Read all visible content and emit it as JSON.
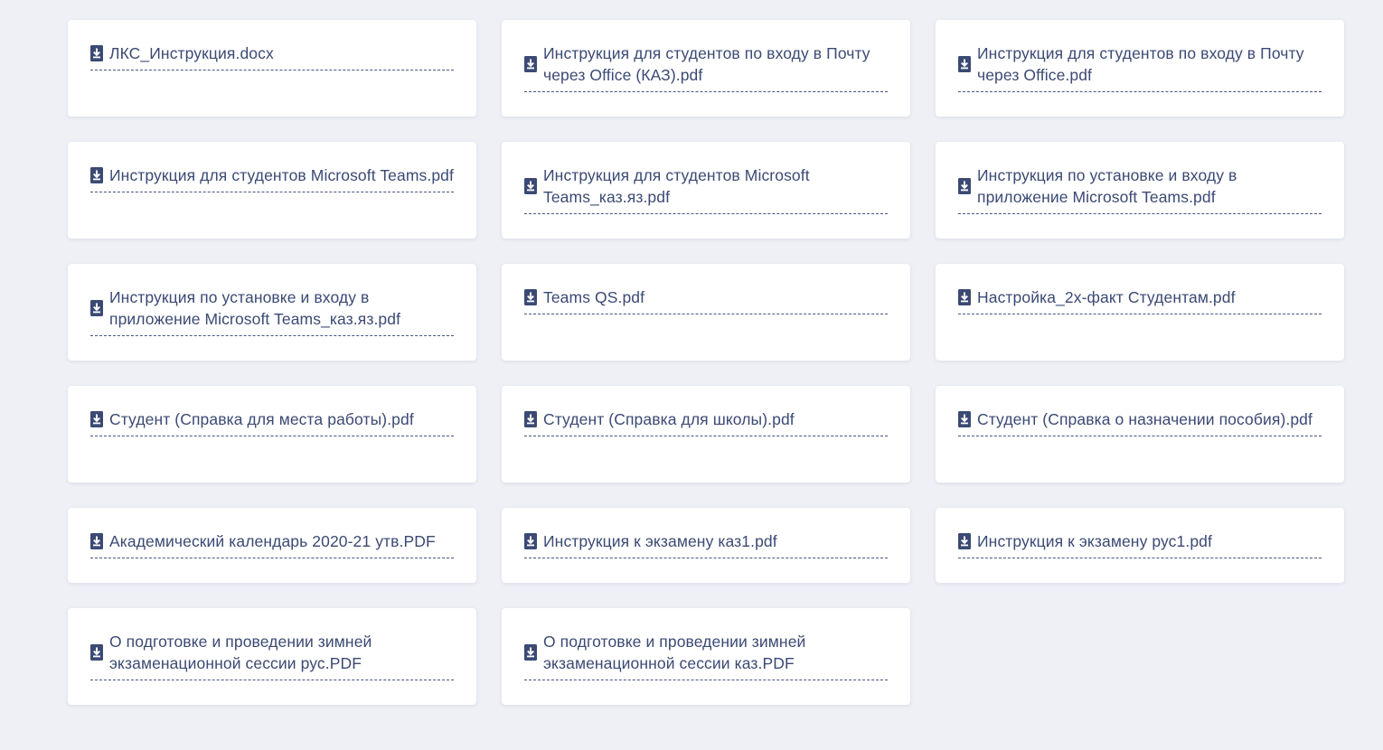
{
  "theme": {
    "background": "#eef0f5",
    "card_background": "#ffffff",
    "link_color": "#3b4a74",
    "icon_color": "#3b4a74"
  },
  "icon": "file-download-icon",
  "documents": [
    {
      "name": "ЛКС_Инструкция.docx"
    },
    {
      "name": "Инструкция для студентов по входу в Почту через Office (КАЗ).pdf"
    },
    {
      "name": "Инструкция для студентов по входу в Почту через Office.pdf"
    },
    {
      "name": "Инструкция для студентов Microsoft Teams.pdf"
    },
    {
      "name": "Инструкция для студентов Microsoft Teams_каз.яз.pdf"
    },
    {
      "name": "Инструкция по установке и входу в приложение Microsoft Teams.pdf"
    },
    {
      "name": "Инструкция по установке и входу в приложение Microsoft Teams_каз.яз.pdf"
    },
    {
      "name": "Teams QS.pdf"
    },
    {
      "name": "Настройка_2х-факт Студентам.pdf"
    },
    {
      "name": "Студент (Справка для места работы).pdf"
    },
    {
      "name": "Студент (Справка для школы).pdf"
    },
    {
      "name": "Студент (Справка о назначении пособия).pdf"
    },
    {
      "name": "Академический календарь 2020-21 утв.PDF"
    },
    {
      "name": "Инструкция к экзамену каз1.pdf"
    },
    {
      "name": "Инструкция к экзамену рус1.pdf"
    },
    {
      "name": "О подготовке и проведении зимней экзаменационной сессии рус.PDF"
    },
    {
      "name": "О подготовке и проведении зимней экзаменационной сессии каз.PDF"
    }
  ]
}
